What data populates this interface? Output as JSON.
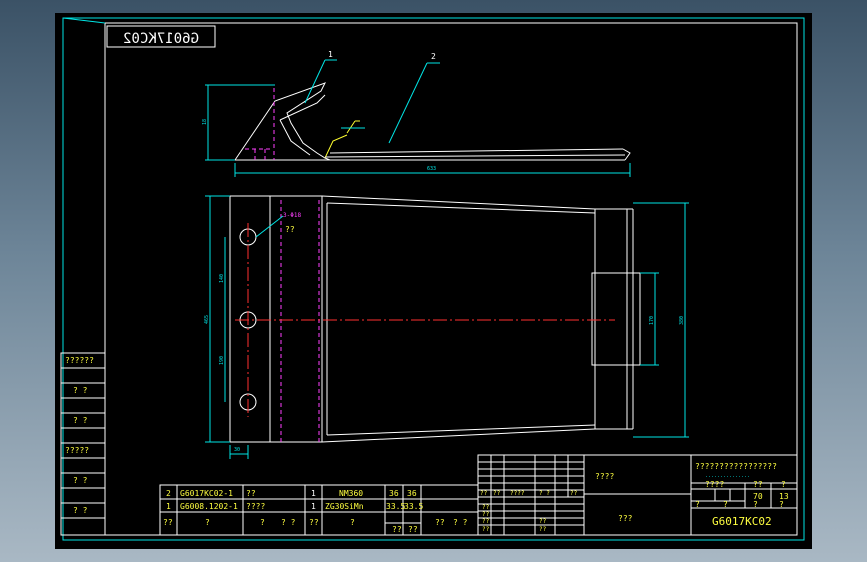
{
  "drawing": {
    "stamp": "G6017KC02",
    "callout_1": "1",
    "callout_2": "2",
    "dim_height": "18",
    "dim_length": "633",
    "dim_hole": "3-Φ18",
    "dim_hole_note": "??",
    "dim_140": "140",
    "dim_465": "465",
    "dim_190": "190",
    "dim_30": "30",
    "dim_170": "170",
    "dim_380": "380"
  },
  "side_labels": [
    "??????",
    "? ?",
    "? ?",
    "?????",
    "? ?",
    "? ?"
  ],
  "parts_list": {
    "rows": [
      {
        "no": "2",
        "code": "G6017KC02-1",
        "name": "??",
        "qty": "1",
        "material": "NM360",
        "w1": "36",
        "w2": "36"
      },
      {
        "no": "1",
        "code": "G6008.1202-1",
        "name": "????",
        "qty": "1",
        "material": "ZG30SiMn",
        "w1": "33.5",
        "w2": "33.5"
      }
    ],
    "header": [
      "??",
      "?",
      "?",
      "? ?",
      "??",
      "?",
      "??",
      "??",
      "??",
      "? ?"
    ]
  },
  "title_block": {
    "cell_a": "????",
    "cell_b": "???",
    "title": "?????????????????",
    "dots": "...............",
    "sub_labels": [
      "????",
      "??",
      "?"
    ],
    "weight": "70",
    "scale": "13",
    "drawing_no": "G6017KC02",
    "sign_row": [
      "??",
      "??",
      "????",
      "? ?",
      "??"
    ],
    "grid_labels": [
      "??",
      "??",
      "??",
      "??",
      "??",
      "??"
    ],
    "bottom_marks": [
      "?",
      "?",
      "?",
      "?"
    ]
  }
}
